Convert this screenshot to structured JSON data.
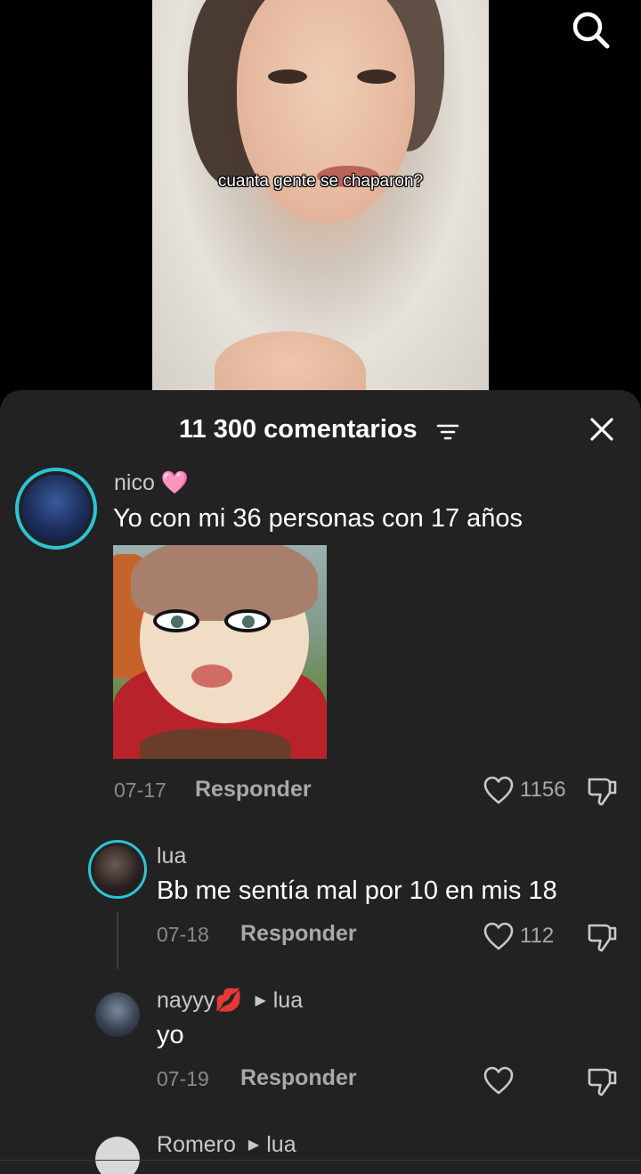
{
  "video": {
    "caption": "cuanta gente se chaparon?"
  },
  "header": {
    "title": "11 300 comentarios"
  },
  "comments": [
    {
      "username": "nico 🩷",
      "text": "Yo con mi 36 personas con 17 años",
      "date": "07-17",
      "reply": "Responder",
      "likes": "1156"
    },
    {
      "username": "lua",
      "text": "Bb me sentía mal por 10 en mis 18",
      "date": "07-18",
      "reply": "Responder",
      "likes": "112"
    },
    {
      "username": "nayyy💋",
      "reply_to": "lua",
      "text": "yo",
      "date": "07-19",
      "reply": "Responder",
      "likes": ""
    },
    {
      "username": "Romero",
      "reply_to": "lua"
    }
  ],
  "colors": {
    "sheet_bg": "#222222",
    "avatar_ring": "#2bc4d6",
    "muted_text": "#a9a9a9"
  },
  "icons": {
    "search": "search-icon",
    "filter": "filter-icon",
    "close": "close-icon",
    "like": "heart-icon",
    "dislike": "thumbs-down-icon"
  }
}
